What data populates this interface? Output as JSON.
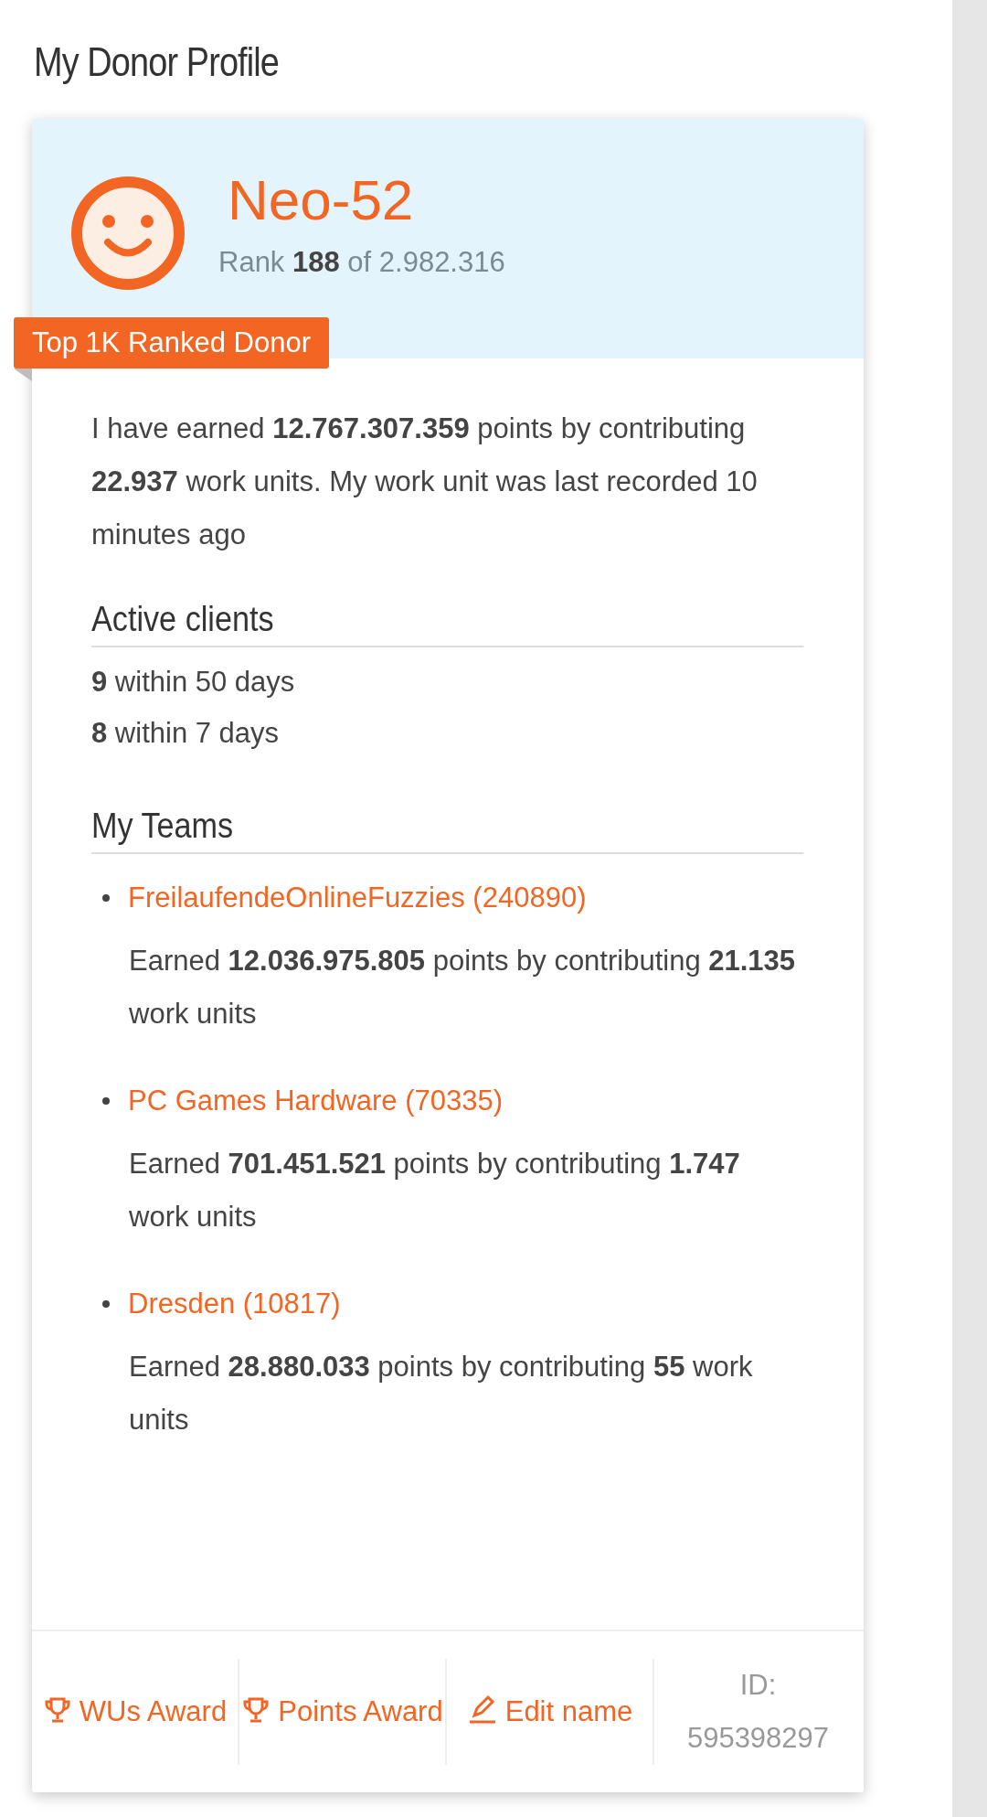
{
  "page_title": "My Donor Profile",
  "profile": {
    "name": "Neo-52",
    "rank_prefix": "Rank",
    "rank": "188",
    "rank_suffix": "of 2.982.316",
    "badge": "Top 1K Ranked Donor"
  },
  "summary": "I have earned **12.767.307.359** points by contributing **22.937** work units. My work unit was last recorded 10 minutes ago",
  "active_clients": {
    "heading": "Active clients",
    "items": [
      {
        "count": "9",
        "label": "within 50 days"
      },
      {
        "count": "8",
        "label": "within 7 days"
      }
    ]
  },
  "teams": {
    "heading": "My Teams",
    "items": [
      {
        "name": "FreilaufendeOnlineFuzzies (240890)",
        "description": "Earned **12.036.975.805** points by contributing **21.135** work units"
      },
      {
        "name": "PC Games Hardware (70335)",
        "description": "Earned **701.451.521** points by contributing **1.747** work units"
      },
      {
        "name": "Dresden (10817)",
        "description": "Earned **28.880.033** points by contributing **55** work units"
      }
    ]
  },
  "footer": [
    {
      "kind": "trophy",
      "label": "WUs Award"
    },
    {
      "kind": "trophy",
      "label": "Points Award"
    },
    {
      "kind": "pencil",
      "label": "Edit name"
    },
    {
      "kind": "id",
      "label": "ID: 595398297"
    }
  ]
}
